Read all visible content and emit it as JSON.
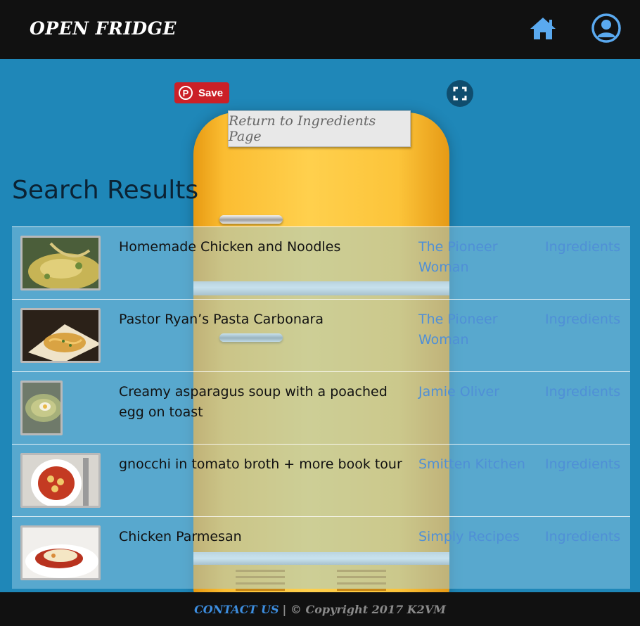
{
  "header": {
    "brand": "OPEN FRIDGE",
    "home_icon": "home-icon",
    "account_icon": "user-circle-icon",
    "icon_color": "#5aa9ef"
  },
  "controls": {
    "pin_label": "Save",
    "return_label": "Return to Ingredients Page"
  },
  "page_title": "Search Results",
  "results": [
    {
      "title": "Homemade Chicken and Noodles",
      "source": "The Pioneer Woman",
      "action": "Ingredients",
      "image": "chicken-noodles-photo"
    },
    {
      "title": "Pastor Ryan’s Pasta Carbonara",
      "source": "The Pioneer Woman",
      "action": "Ingredients",
      "image": "pasta-carbonara-photo"
    },
    {
      "title": "Creamy asparagus soup with a poached egg on toast",
      "source": "Jamie Oliver",
      "action": "Ingredients",
      "image": "asparagus-soup-photo"
    },
    {
      "title": "gnocchi in tomato broth + more book tour",
      "source": "Smitten Kitchen",
      "action": "Ingredients",
      "image": "gnocchi-photo"
    },
    {
      "title": "Chicken Parmesan",
      "source": "Simply Recipes",
      "action": "Ingredients",
      "image": "chicken-parmesan-photo"
    }
  ],
  "footer": {
    "contact": "CONTACT US",
    "copyright": "| © Copyright 2017 K2VM"
  },
  "colors": {
    "background": "#1f87b8",
    "link": "#4f8fd6",
    "header": "#111111",
    "pinterest": "#cb2027"
  }
}
